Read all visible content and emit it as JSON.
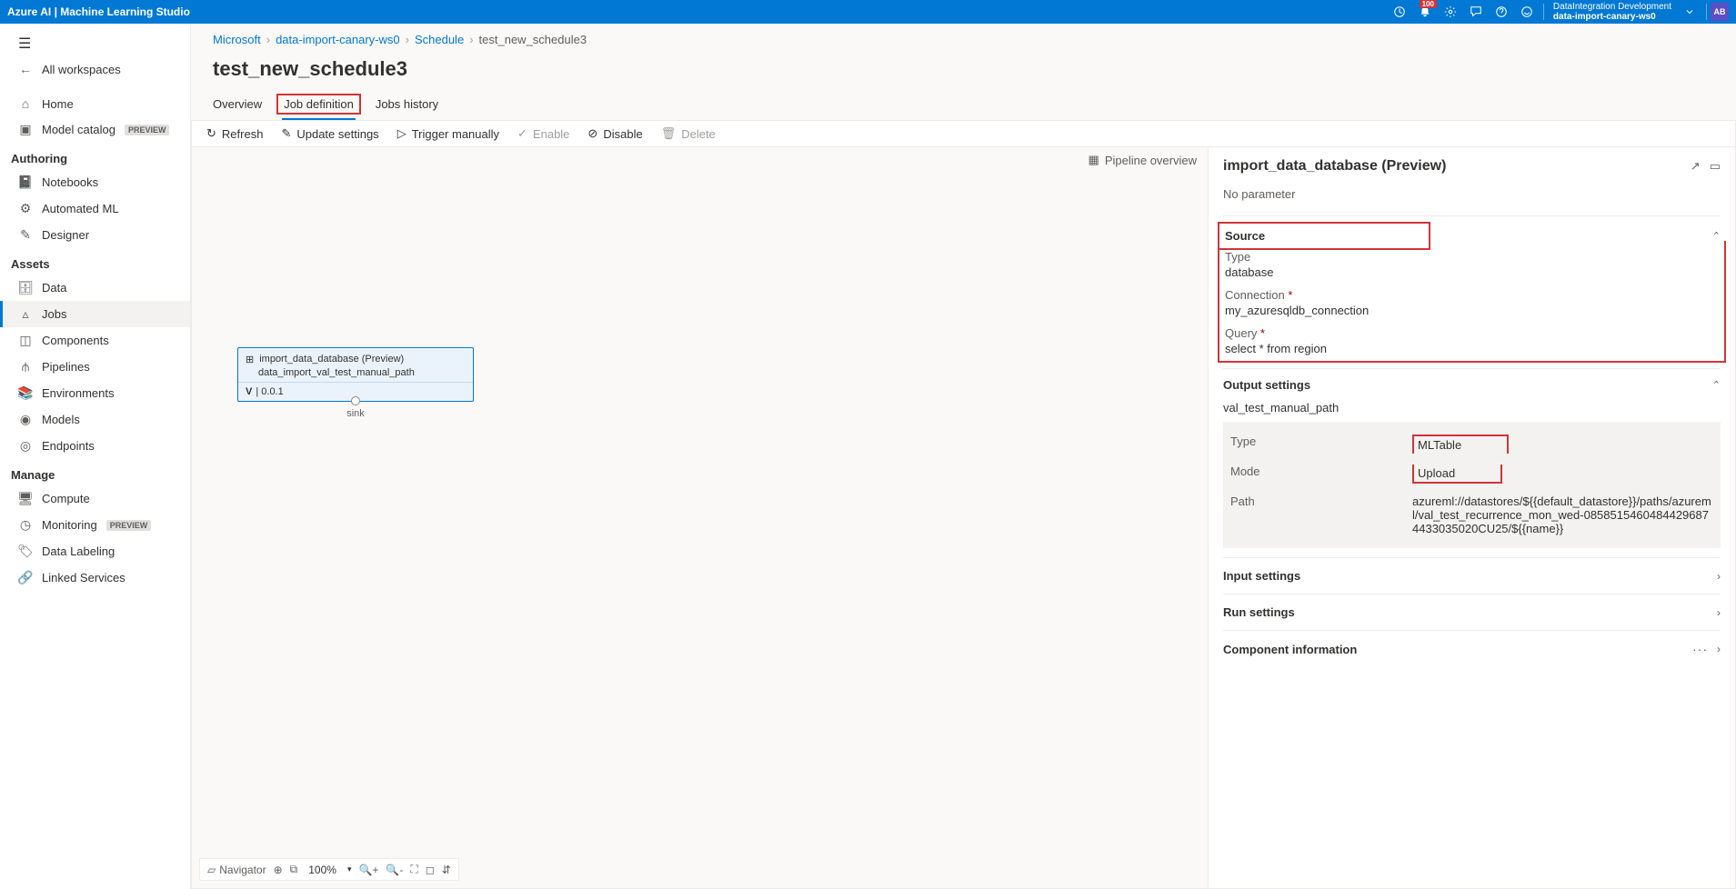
{
  "topbar": {
    "title": "Azure AI | Machine Learning Studio",
    "notification_count": "100",
    "workspace_top": "DataIntegration Development",
    "workspace_bottom": "data-import-canary-ws0",
    "avatar": "AB"
  },
  "sidebar": {
    "all_workspaces": "All workspaces",
    "home": "Home",
    "model_catalog": "Model catalog",
    "preview": "PREVIEW",
    "section_authoring": "Authoring",
    "notebooks": "Notebooks",
    "automl": "Automated ML",
    "designer": "Designer",
    "section_assets": "Assets",
    "data": "Data",
    "jobs": "Jobs",
    "components": "Components",
    "pipelines": "Pipelines",
    "environments": "Environments",
    "models": "Models",
    "endpoints": "Endpoints",
    "section_manage": "Manage",
    "compute": "Compute",
    "monitoring": "Monitoring",
    "data_labeling": "Data Labeling",
    "linked_services": "Linked Services"
  },
  "breadcrumb": {
    "0": "Microsoft",
    "1": "data-import-canary-ws0",
    "2": "Schedule",
    "3": "test_new_schedule3"
  },
  "page_title": "test_new_schedule3",
  "tabs": {
    "overview": "Overview",
    "job_definition": "Job definition",
    "jobs_history": "Jobs history"
  },
  "toolbar": {
    "refresh": "Refresh",
    "update_settings": "Update settings",
    "trigger_manually": "Trigger manually",
    "enable": "Enable",
    "disable": "Disable",
    "delete": "Delete"
  },
  "pipeline_overview": "Pipeline overview",
  "node": {
    "title": "import_data_database (Preview)",
    "subtitle": "data_import_val_test_manual_path",
    "version": "0.0.1",
    "port_label": "sink"
  },
  "canvas_toolbar": {
    "navigator": "Navigator",
    "zoom": "100%"
  },
  "details": {
    "title": "import_data_database (Preview)",
    "no_param": "No parameter",
    "source": {
      "label": "Source",
      "type_k": "Type",
      "type_v": "database",
      "conn_k": "Connection",
      "conn_v": "my_azuresqldb_connection",
      "query_k": "Query",
      "query_v": "select * from region"
    },
    "output": {
      "label": "Output settings",
      "subtitle": "val_test_manual_path",
      "type_k": "Type",
      "type_v": "MLTable",
      "mode_k": "Mode",
      "mode_v": "Upload",
      "path_k": "Path",
      "path_v": "azureml://datastores/${{default_datastore}}/paths/azureml/val_test_recurrence_mon_wed-08585154604844296874433035020CU25/${{name}}"
    },
    "input_settings": "Input settings",
    "run_settings": "Run settings",
    "component_info": "Component information"
  }
}
